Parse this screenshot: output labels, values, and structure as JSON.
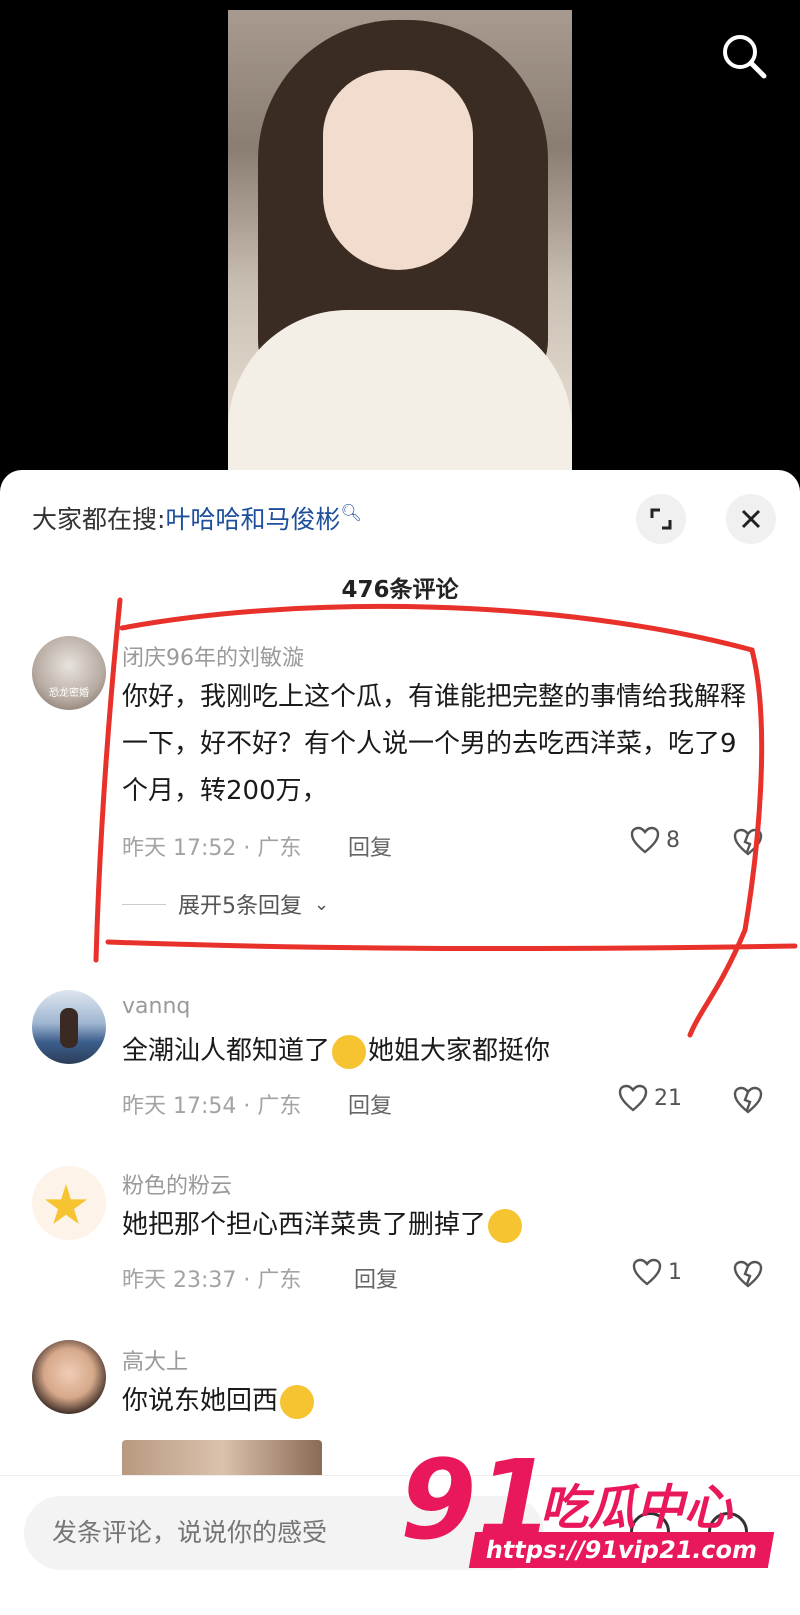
{
  "hot_search": {
    "prefix": "大家都在搜:",
    "keyword": "叶哈哈和马俊彬"
  },
  "comment_count": "476条评论",
  "comments": [
    {
      "username": "闭庆96年的刘敏漩",
      "avatar_caption": "恐龙密婚",
      "text": "你好，我刚吃上这个瓜，有谁能把完整的事情给我解释一下，好不好？有个人说一个男的去吃西洋菜，吃了9个月，转200万，",
      "meta": "昨天 17:52 · 广东",
      "reply_label": "回复",
      "likes": "8",
      "expand_label": "展开5条回复"
    },
    {
      "username": "vannq",
      "text_before": "全潮汕人都知道了",
      "text_after": "她姐大家都挺你",
      "meta": "昨天 17:54 · 广东",
      "reply_label": "回复",
      "likes": "21"
    },
    {
      "username": "粉色的粉云",
      "text": "她把那个担心西洋菜贵了删掉了",
      "meta": "昨天 23:37 · 广东",
      "reply_label": "回复",
      "likes": "1"
    },
    {
      "username": "高大上",
      "text": "你说东她回西"
    }
  ],
  "input": {
    "placeholder": "发条评论，说说你的感受"
  },
  "watermark": {
    "number": "91",
    "name": "吃瓜中心",
    "url": "https://91vip21.com"
  },
  "colors": {
    "annotation": "#e8312a",
    "link": "#1e4f9c",
    "watermark": "#e8185a"
  }
}
